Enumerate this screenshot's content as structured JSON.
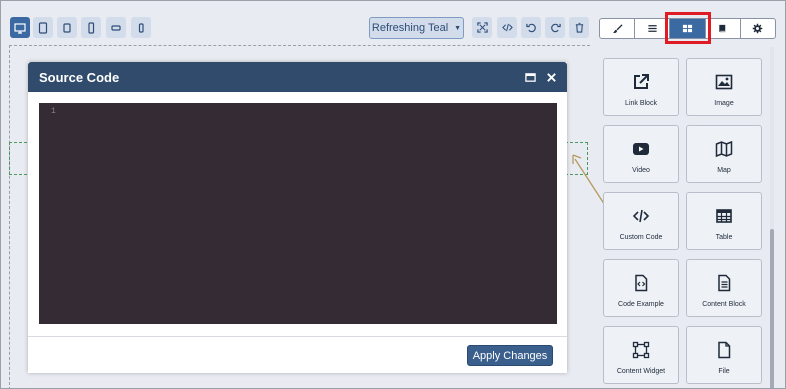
{
  "theme_select": {
    "value": "Refreshing Teal"
  },
  "devices": [
    {
      "name": "desktop-icon"
    },
    {
      "name": "tablet-icon"
    },
    {
      "name": "tablet-small-icon"
    },
    {
      "name": "phone-icon"
    },
    {
      "name": "phone-landscape-icon"
    },
    {
      "name": "phone-small-icon"
    }
  ],
  "toolbar": [
    {
      "name": "fullscreen-icon"
    },
    {
      "name": "code-icon"
    },
    {
      "name": "undo-icon"
    },
    {
      "name": "redo-icon"
    },
    {
      "name": "trash-icon"
    }
  ],
  "panel_tabs": [
    {
      "name": "brush-icon"
    },
    {
      "name": "layers-icon"
    },
    {
      "name": "blocks-icon",
      "active": true
    },
    {
      "name": "book-icon"
    },
    {
      "name": "settings-icon"
    }
  ],
  "modal": {
    "title": "Source Code",
    "line_number": "1",
    "apply_label": "Apply Changes"
  },
  "blocks": [
    {
      "label": "Link Block",
      "icon": "external-link-icon"
    },
    {
      "label": "Image",
      "icon": "image-icon"
    },
    {
      "label": "Video",
      "icon": "video-icon"
    },
    {
      "label": "Map",
      "icon": "map-icon"
    },
    {
      "label": "Custom Code",
      "icon": "code-icon"
    },
    {
      "label": "Table",
      "icon": "table-icon"
    },
    {
      "label": "Code Example",
      "icon": "code-file-icon"
    },
    {
      "label": "Content Block",
      "icon": "document-icon"
    },
    {
      "label": "Content Widget",
      "icon": "widget-icon"
    },
    {
      "label": "File",
      "icon": "file-icon"
    }
  ],
  "colors": {
    "accent": "#3b6aa3",
    "modal_header": "#304b6c",
    "editor_bg": "#352b34",
    "highlight": "#e01b24"
  }
}
